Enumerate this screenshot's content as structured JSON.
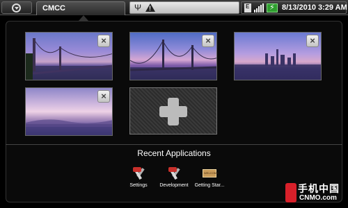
{
  "status_bar": {
    "carrier": "CMCC",
    "data_indicator": "E",
    "time": "8/13/2010 3:29 AM",
    "icons": [
      "menu-icon",
      "usb-icon",
      "warning-icon",
      "data-edge-icon",
      "signal-icon",
      "battery-charging-icon"
    ]
  },
  "browser_windows": [
    {
      "name": "window-1",
      "close_label": "×"
    },
    {
      "name": "window-2",
      "close_label": "×"
    },
    {
      "name": "window-3",
      "close_label": "×"
    },
    {
      "name": "window-4",
      "close_label": "×"
    }
  ],
  "add_window": {
    "icon": "plus-icon"
  },
  "recent": {
    "title": "Recent Applications",
    "apps": [
      {
        "label": "Settings",
        "icon": "settings-tools-icon"
      },
      {
        "label": "Development",
        "icon": "development-tools-icon"
      },
      {
        "label": "Getting Star...",
        "icon": "welcome-card-icon"
      }
    ]
  },
  "watermark": {
    "cn": "手机中国",
    "en": "CNMO.com"
  },
  "colors": {
    "background": "#000000",
    "panel": "#0a0a0a",
    "accent_green": "#2f9e2f"
  }
}
